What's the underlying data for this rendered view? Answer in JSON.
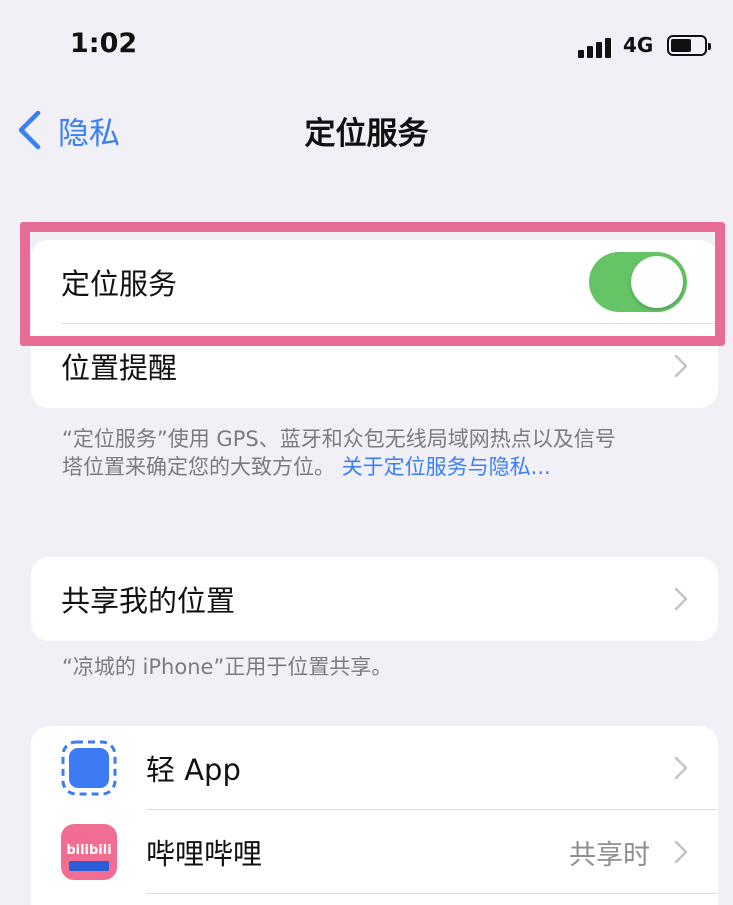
{
  "status_bar": {
    "time": "1:02",
    "network": "4G",
    "icons": [
      "signal-icon",
      "battery-icon"
    ]
  },
  "nav": {
    "back_label": "隐私",
    "title": "定位服务",
    "back_icon": "chevron-left-icon"
  },
  "location_group": {
    "toggle_label": "定位服务",
    "toggle_on": true,
    "reminder_label": "位置提醒"
  },
  "location_footnote": {
    "text_line1": "“定位服务”使用 GPS、蓝牙和众包无线局域网热点以及信号",
    "text_line2": "塔位置来确定您的大致方位。",
    "link": "关于定位服务与隐私..."
  },
  "share_group": {
    "label": "共享我的位置"
  },
  "share_footnote": "“凉城的 iPhone”正用于位置共享。",
  "apps": [
    {
      "name": "轻 App",
      "value": "",
      "icon": "light-app-icon"
    },
    {
      "name": "哔哩哔哩",
      "value": "共享时",
      "icon": "bilibili-icon"
    }
  ],
  "bilibili_icon_text": "bilibili",
  "colors": {
    "accent": "#3a7ff6",
    "toggle_on": "#65c466",
    "highlight": "#e76c96",
    "background": "#f1f0f6"
  }
}
